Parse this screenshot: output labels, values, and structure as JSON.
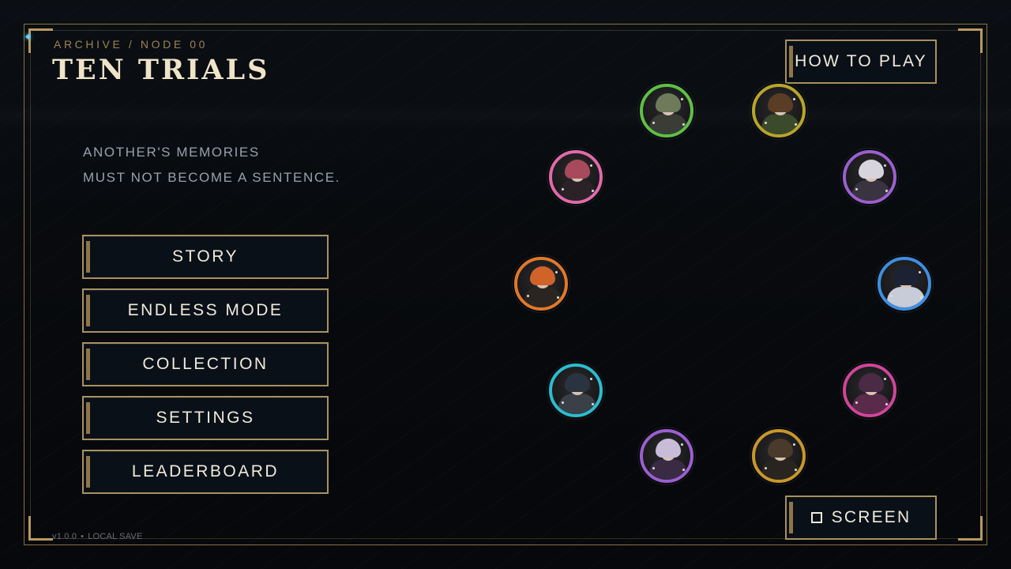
{
  "header": {
    "kicker": "ARCHIVE / NODE 00",
    "title": "TEN TRIALS",
    "tagline_line1": "ANOTHER'S MEMORIES",
    "tagline_line2": "MUST NOT BECOME A SENTENCE."
  },
  "menu": {
    "story": "STORY",
    "endless": "ENDLESS MODE",
    "collection": "COLLECTION",
    "settings": "SETTINGS",
    "leaderboard": "LEADERBOARD"
  },
  "corner_buttons": {
    "how_to_play": "HOW TO PLAY",
    "screen": "SCREEN"
  },
  "footer": {
    "version": "v1.0.0",
    "save": "LOCAL SAVE"
  },
  "colors": {
    "gold": "#a8915f",
    "background": "#07090c"
  },
  "portraits": [
    {
      "name": "portrait-green",
      "ring": "#5fbf45",
      "hair": "#6d7b5a",
      "body": "#3a3d35"
    },
    {
      "name": "portrait-olive",
      "ring": "#b7a52c",
      "hair": "#5a3d24",
      "body": "#3a4a2a"
    },
    {
      "name": "portrait-pink",
      "ring": "#e06aa8",
      "hair": "#a84a5c",
      "body": "#2a2226"
    },
    {
      "name": "portrait-violet",
      "ring": "#9b5fd0",
      "hair": "#d8d4de",
      "body": "#3a3340"
    },
    {
      "name": "portrait-orange",
      "ring": "#e0782a",
      "hair": "#d0622a",
      "body": "#2a2520"
    },
    {
      "name": "portrait-blue",
      "ring": "#3f8ee0",
      "hair": "#1c2234",
      "body": "#c8ccd8"
    },
    {
      "name": "portrait-cyan",
      "ring": "#2cbccf",
      "hair": "#2a3440",
      "body": "#3a4048"
    },
    {
      "name": "portrait-magenta",
      "ring": "#d0459a",
      "hair": "#4a2a44",
      "body": "#5a2a4a"
    },
    {
      "name": "portrait-purple",
      "ring": "#9a5fd0",
      "hair": "#c8bcd8",
      "body": "#3a2a44"
    },
    {
      "name": "portrait-gold",
      "ring": "#c9972a",
      "hair": "#4a3a2a",
      "body": "#2a2420"
    }
  ]
}
